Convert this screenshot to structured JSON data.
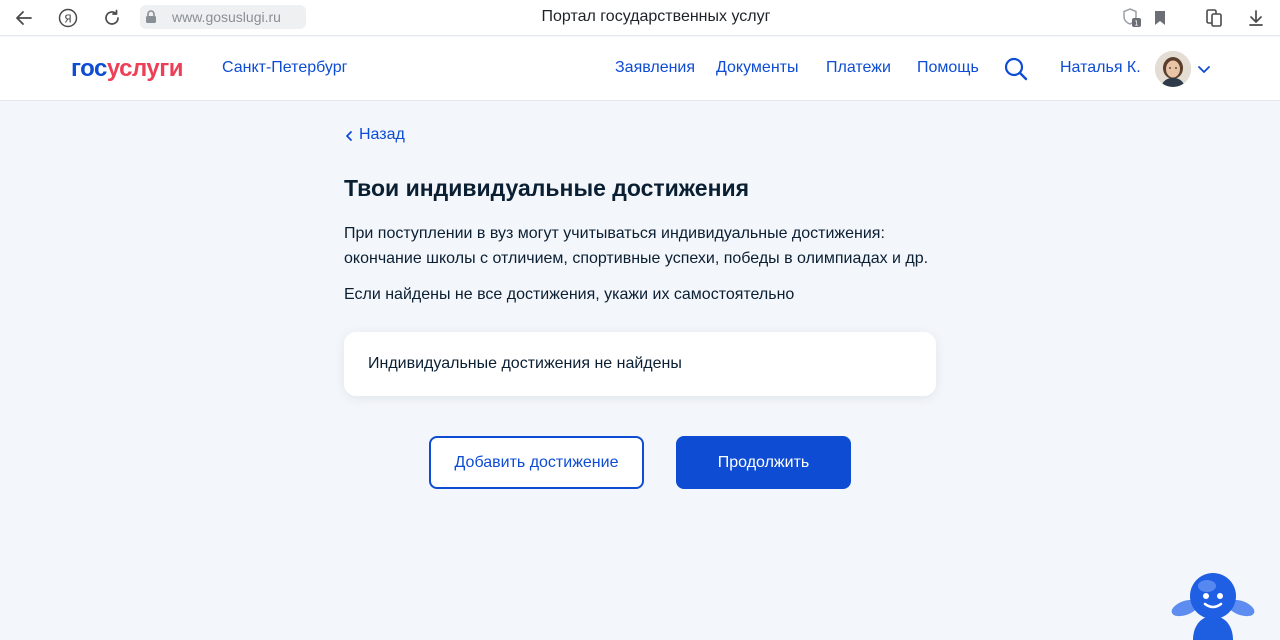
{
  "browser": {
    "url": "www.gosuslugi.ru",
    "tab_title": "Портал государственных услуг",
    "icons": [
      "back-arrow-icon",
      "yandex-icon",
      "reload-icon",
      "lock-icon",
      "protect-icon",
      "bookmark-icon",
      "collections-icon",
      "download-icon"
    ],
    "protect_badge": "1"
  },
  "header": {
    "logo_part1": "гос",
    "logo_part2": "услуги",
    "region": "Санкт-Петербург",
    "nav": [
      "Заявления",
      "Документы",
      "Платежи",
      "Помощь"
    ],
    "user_name": "Наталья К.",
    "accent": "#0d4cd3",
    "brand_red": "#ee3f58"
  },
  "main": {
    "back_label": "Назад",
    "title": "Твои индивидуальные достижения",
    "description_line1": "При поступлении в вуз могут учитываться индивидуальные достижения:",
    "description_line2": "окончание школы с отличием, спортивные успехи, победы в олимпиадах и др.",
    "note": "Если найдены не все достижения, укажи их самостоятельно",
    "empty_state": "Индивидуальные достижения не найдены",
    "add_button": "Добавить достижение",
    "continue_button": "Продолжить"
  }
}
